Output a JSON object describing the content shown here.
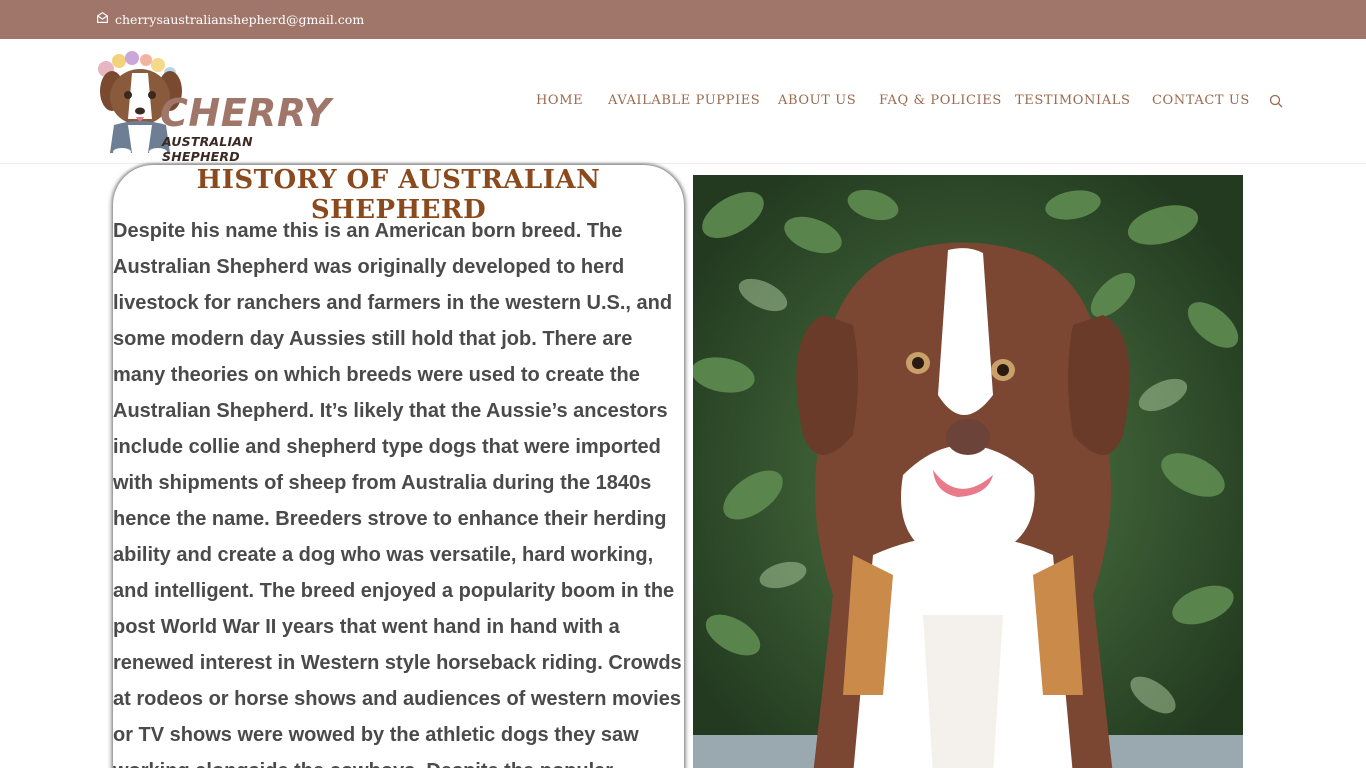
{
  "topbar": {
    "email": "cherrysaustralianshepherd@gmail.com",
    "email_icon": "envelope-icon"
  },
  "header": {
    "logo": {
      "brand": "CHERRY",
      "subtitle": "AUSTRALIAN SHEPHERD"
    },
    "nav": [
      {
        "label": "HOME"
      },
      {
        "label": "AVAILABLE PUPPIES"
      },
      {
        "label": "ABOUT US"
      },
      {
        "label": "FAQ & POLICIES"
      },
      {
        "label": "TESTIMONIALS"
      },
      {
        "label": "CONTACT US"
      }
    ],
    "search_icon": "search-icon"
  },
  "history": {
    "title": "HISTORY OF AUSTRALIAN SHEPHERD",
    "body": "Despite his name this is an American born breed. The Australian Shepherd was originally developed to herd livestock for ranchers and farmers in the western U.S., and some modern day Aussies still hold that job. There are many theories on which breeds were used to create the Australian Shepherd. It’s likely that the Aussie’s ancestors include collie and shepherd type dogs that were imported with shipments of sheep from Australia during the 1840s hence the name. Breeders strove to enhance their herding ability and create a dog who was versatile, hard working, and intelligent. The breed enjoyed a popularity boom in the post World War II years that went hand in hand with a renewed interest in Western style horseback riding. Crowds at rodeos or horse shows and audiences of western movies or TV shows were wowed by the athletic dogs they saw working alongside the cowboys. Despite the popular"
  },
  "colors": {
    "topbar": "#a0766a",
    "nav_text": "#9a6a4e",
    "title": "#8a4a1e",
    "body_text": "#4a4a4a"
  }
}
